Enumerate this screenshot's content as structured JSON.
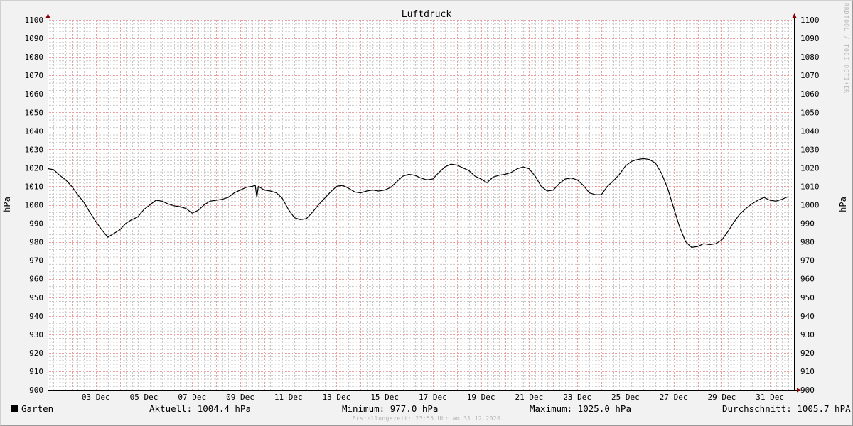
{
  "chart_data": {
    "type": "line",
    "title": "Luftdruck",
    "ylabel": "hPa",
    "ylim": [
      900,
      1100
    ],
    "yticks": [
      900,
      910,
      920,
      930,
      940,
      950,
      960,
      970,
      980,
      990,
      1000,
      1010,
      1020,
      1030,
      1040,
      1050,
      1060,
      1070,
      1080,
      1090,
      1100
    ],
    "xlim": [
      "2020-12-01T00:00",
      "2021-01-01T00:00"
    ],
    "xticks": [
      {
        "label": "03 Dec",
        "date": "2020-12-03"
      },
      {
        "label": "05 Dec",
        "date": "2020-12-05"
      },
      {
        "label": "07 Dec",
        "date": "2020-12-07"
      },
      {
        "label": "09 Dec",
        "date": "2020-12-09"
      },
      {
        "label": "11 Dec",
        "date": "2020-12-11"
      },
      {
        "label": "13 Dec",
        "date": "2020-12-13"
      },
      {
        "label": "15 Dec",
        "date": "2020-12-15"
      },
      {
        "label": "17 Dec",
        "date": "2020-12-17"
      },
      {
        "label": "19 Dec",
        "date": "2020-12-19"
      },
      {
        "label": "21 Dec",
        "date": "2020-12-21"
      },
      {
        "label": "23 Dec",
        "date": "2020-12-23"
      },
      {
        "label": "25 Dec",
        "date": "2020-12-25"
      },
      {
        "label": "27 Dec",
        "date": "2020-12-27"
      },
      {
        "label": "29 Dec",
        "date": "2020-12-29"
      },
      {
        "label": "31 Dec",
        "date": "2020-12-31"
      }
    ],
    "grid": true,
    "series": [
      {
        "name": "Garten",
        "color": "#000000",
        "points": [
          [
            "2020-12-01T00:00",
            1019.6
          ],
          [
            "2020-12-01T06:00",
            1019.0
          ],
          [
            "2020-12-01T12:00",
            1016.0
          ],
          [
            "2020-12-01T18:00",
            1013.5
          ],
          [
            "2020-12-02T00:00",
            1010.0
          ],
          [
            "2020-12-02T06:00",
            1005.5
          ],
          [
            "2020-12-02T12:00",
            1001.5
          ],
          [
            "2020-12-02T18:00",
            996.0
          ],
          [
            "2020-12-03T00:00",
            991.0
          ],
          [
            "2020-12-03T06:00",
            986.5
          ],
          [
            "2020-12-03T12:00",
            982.5
          ],
          [
            "2020-12-03T18:00",
            984.5
          ],
          [
            "2020-12-04T00:00",
            986.5
          ],
          [
            "2020-12-04T06:00",
            990.0
          ],
          [
            "2020-12-04T12:00",
            992.0
          ],
          [
            "2020-12-04T18:00",
            993.5
          ],
          [
            "2020-12-05T00:00",
            997.5
          ],
          [
            "2020-12-05T06:00",
            1000.0
          ],
          [
            "2020-12-05T12:00",
            1002.5
          ],
          [
            "2020-12-05T18:00",
            1002.0
          ],
          [
            "2020-12-06T00:00",
            1000.5
          ],
          [
            "2020-12-06T06:00",
            999.5
          ],
          [
            "2020-12-06T12:00",
            999.0
          ],
          [
            "2020-12-06T18:00",
            998.0
          ],
          [
            "2020-12-07T00:00",
            995.5
          ],
          [
            "2020-12-07T06:00",
            997.0
          ],
          [
            "2020-12-07T12:00",
            1000.0
          ],
          [
            "2020-12-07T18:00",
            1002.0
          ],
          [
            "2020-12-08T00:00",
            1002.5
          ],
          [
            "2020-12-08T06:00",
            1003.0
          ],
          [
            "2020-12-08T12:00",
            1004.0
          ],
          [
            "2020-12-08T18:00",
            1006.5
          ],
          [
            "2020-12-09T00:00",
            1008.0
          ],
          [
            "2020-12-09T06:00",
            1009.5
          ],
          [
            "2020-12-09T12:00",
            1010.0
          ],
          [
            "2020-12-09T15:00",
            1010.5
          ],
          [
            "2020-12-09T16:30",
            1004.0
          ],
          [
            "2020-12-09T18:00",
            1010.0
          ],
          [
            "2020-12-10T00:00",
            1008.0
          ],
          [
            "2020-12-10T06:00",
            1007.5
          ],
          [
            "2020-12-10T12:00",
            1006.5
          ],
          [
            "2020-12-10T18:00",
            1003.5
          ],
          [
            "2020-12-11T00:00",
            997.5
          ],
          [
            "2020-12-11T06:00",
            993.0
          ],
          [
            "2020-12-11T12:00",
            992.0
          ],
          [
            "2020-12-11T18:00",
            992.5
          ],
          [
            "2020-12-12T00:00",
            996.0
          ],
          [
            "2020-12-12T06:00",
            1000.0
          ],
          [
            "2020-12-12T12:00",
            1003.5
          ],
          [
            "2020-12-12T18:00",
            1007.0
          ],
          [
            "2020-12-13T00:00",
            1010.0
          ],
          [
            "2020-12-13T06:00",
            1010.5
          ],
          [
            "2020-12-13T12:00",
            1009.0
          ],
          [
            "2020-12-13T18:00",
            1007.0
          ],
          [
            "2020-12-14T00:00",
            1006.5
          ],
          [
            "2020-12-14T06:00",
            1007.5
          ],
          [
            "2020-12-14T12:00",
            1008.0
          ],
          [
            "2020-12-14T18:00",
            1007.5
          ],
          [
            "2020-12-15T00:00",
            1008.0
          ],
          [
            "2020-12-15T06:00",
            1009.5
          ],
          [
            "2020-12-15T12:00",
            1012.5
          ],
          [
            "2020-12-15T18:00",
            1015.5
          ],
          [
            "2020-12-16T00:00",
            1016.5
          ],
          [
            "2020-12-16T06:00",
            1016.0
          ],
          [
            "2020-12-16T12:00",
            1014.5
          ],
          [
            "2020-12-16T18:00",
            1013.5
          ],
          [
            "2020-12-17T00:00",
            1014.0
          ],
          [
            "2020-12-17T06:00",
            1017.5
          ],
          [
            "2020-12-17T12:00",
            1020.5
          ],
          [
            "2020-12-17T18:00",
            1022.0
          ],
          [
            "2020-12-18T00:00",
            1021.5
          ],
          [
            "2020-12-18T06:00",
            1020.0
          ],
          [
            "2020-12-18T12:00",
            1018.5
          ],
          [
            "2020-12-18T18:00",
            1015.5
          ],
          [
            "2020-12-19T00:00",
            1014.0
          ],
          [
            "2020-12-19T06:00",
            1012.0
          ],
          [
            "2020-12-19T12:00",
            1015.0
          ],
          [
            "2020-12-19T18:00",
            1016.0
          ],
          [
            "2020-12-20T00:00",
            1016.5
          ],
          [
            "2020-12-20T06:00",
            1017.5
          ],
          [
            "2020-12-20T12:00",
            1019.5
          ],
          [
            "2020-12-20T18:00",
            1020.5
          ],
          [
            "2020-12-21T00:00",
            1019.5
          ],
          [
            "2020-12-21T06:00",
            1015.5
          ],
          [
            "2020-12-21T12:00",
            1010.0
          ],
          [
            "2020-12-21T18:00",
            1007.5
          ],
          [
            "2020-12-22T00:00",
            1008.0
          ],
          [
            "2020-12-22T06:00",
            1011.5
          ],
          [
            "2020-12-22T12:00",
            1014.0
          ],
          [
            "2020-12-22T18:00",
            1014.5
          ],
          [
            "2020-12-23T00:00",
            1013.5
          ],
          [
            "2020-12-23T06:00",
            1010.5
          ],
          [
            "2020-12-23T12:00",
            1006.5
          ],
          [
            "2020-12-23T18:00",
            1005.5
          ],
          [
            "2020-12-24T00:00",
            1005.5
          ],
          [
            "2020-12-24T06:00",
            1010.0
          ],
          [
            "2020-12-24T12:00",
            1013.0
          ],
          [
            "2020-12-24T18:00",
            1016.5
          ],
          [
            "2020-12-25T00:00",
            1021.0
          ],
          [
            "2020-12-25T06:00",
            1023.5
          ],
          [
            "2020-12-25T12:00",
            1024.5
          ],
          [
            "2020-12-25T18:00",
            1025.0
          ],
          [
            "2020-12-26T00:00",
            1024.5
          ],
          [
            "2020-12-26T06:00",
            1022.5
          ],
          [
            "2020-12-26T12:00",
            1017.0
          ],
          [
            "2020-12-26T18:00",
            1009.0
          ],
          [
            "2020-12-27T00:00",
            998.5
          ],
          [
            "2020-12-27T06:00",
            988.0
          ],
          [
            "2020-12-27T12:00",
            980.0
          ],
          [
            "2020-12-27T18:00",
            977.0
          ],
          [
            "2020-12-28T00:00",
            977.5
          ],
          [
            "2020-12-28T06:00",
            979.0
          ],
          [
            "2020-12-28T12:00",
            978.5
          ],
          [
            "2020-12-28T18:00",
            979.0
          ],
          [
            "2020-12-29T00:00",
            981.0
          ],
          [
            "2020-12-29T06:00",
            985.5
          ],
          [
            "2020-12-29T12:00",
            990.5
          ],
          [
            "2020-12-29T18:00",
            995.0
          ],
          [
            "2020-12-30T00:00",
            998.0
          ],
          [
            "2020-12-30T06:00",
            1000.5
          ],
          [
            "2020-12-30T12:00",
            1002.5
          ],
          [
            "2020-12-30T18:00",
            1004.0
          ],
          [
            "2020-12-31T00:00",
            1002.5
          ],
          [
            "2020-12-31T06:00",
            1002.0
          ],
          [
            "2020-12-31T12:00",
            1003.0
          ],
          [
            "2020-12-31T18:00",
            1004.4
          ]
        ]
      }
    ],
    "watermark": "RRDTOOL / TOBI OETIKER"
  },
  "legend": {
    "series_label": "Garten",
    "aktuell": "Aktuell: 1004.4 hPa",
    "minimum": "Minimum: 977.0 hPa",
    "maximum": "Maximum: 1025.0 hPa",
    "durchschnitt": "Durchschnitt: 1005.7 hPA"
  },
  "footer": "Erstellungszeit: 23:55 Uhr am 31.12.2020",
  "colors": {
    "background": "#f2f2f2",
    "plot_background": "#ffffff",
    "minor_grid": "#c8c8c8",
    "major_grid": "#e8a0a0",
    "axis_arrow": "#8b0000",
    "line": "#000000"
  }
}
